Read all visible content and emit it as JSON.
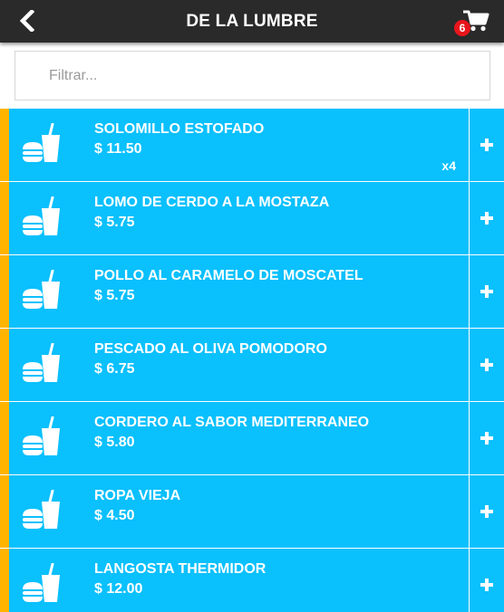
{
  "header": {
    "title": "DE LA LUMBRE",
    "back_icon": "chevron-left-icon",
    "cart_icon": "cart-icon",
    "cart_count": "6"
  },
  "search": {
    "placeholder": "Filtrar...",
    "value": ""
  },
  "colors": {
    "topbar": "#2a2a2a",
    "row_background": "#0ac0fd",
    "row_accent": "#ffb400",
    "badge": "#e8151b"
  },
  "items": [
    {
      "name": "SOLOMILLO ESTOFADO",
      "price": "$ 11.50",
      "quantity": "x4",
      "icon": "burger-drink-icon"
    },
    {
      "name": "LOMO DE CERDO A LA MOSTAZA",
      "price": "$ 5.75",
      "quantity": "",
      "icon": "burger-drink-icon"
    },
    {
      "name": "POLLO AL CARAMELO DE MOSCATEL",
      "price": "$ 5.75",
      "quantity": "",
      "icon": "burger-drink-icon"
    },
    {
      "name": "PESCADO AL OLIVA POMODORO",
      "price": "$ 6.75",
      "quantity": "",
      "icon": "burger-drink-icon"
    },
    {
      "name": "CORDERO AL SABOR MEDITERRANEO",
      "price": "$ 5.80",
      "quantity": "",
      "icon": "burger-drink-icon"
    },
    {
      "name": "ROPA VIEJA",
      "price": "$ 4.50",
      "quantity": "",
      "icon": "burger-drink-icon"
    },
    {
      "name": "LANGOSTA THERMIDOR",
      "price": "$ 12.00",
      "quantity": "",
      "icon": "burger-drink-icon"
    }
  ]
}
